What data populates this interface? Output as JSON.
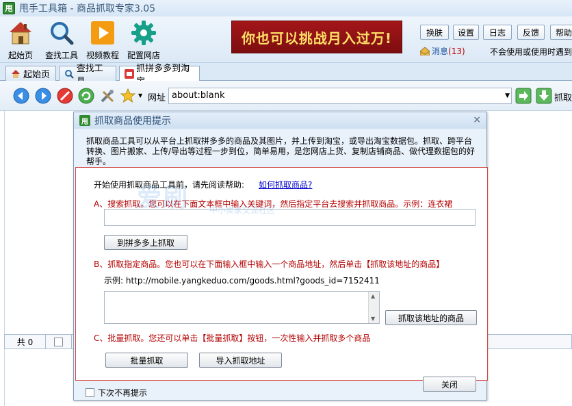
{
  "window": {
    "title": "甩手工具箱 - 商品抓取专家3.05",
    "logo_text": "甩"
  },
  "toolbar": {
    "items": [
      {
        "label": "起始页",
        "icon": "home-icon"
      },
      {
        "label": "查找工具",
        "icon": "search-icon"
      },
      {
        "label": "视频教程",
        "icon": "play-icon"
      },
      {
        "label": "配置网店",
        "icon": "gear-icon"
      }
    ],
    "banner": "你也可以挑战月入过万!",
    "buttons": [
      "换肤",
      "设置",
      "日志",
      "反馈",
      "帮助"
    ],
    "messages_label": "消息",
    "messages_count": "(13)",
    "marquee": "不会使用或使用时遇到"
  },
  "tabs": [
    {
      "label": "起始页",
      "icon": "home-icon"
    },
    {
      "label": "查找工具",
      "icon": "search-icon"
    },
    {
      "label": "抓拼多多到淘宝",
      "icon": "grab-icon",
      "active": true
    }
  ],
  "navbar": {
    "url_label": "网址",
    "url_value": "about:blank",
    "grab_label": "抓取"
  },
  "list": {
    "count_label": "共 0"
  },
  "dialog": {
    "title": "抓取商品使用提示",
    "logo_text": "甩",
    "close": "×",
    "intro": "抓取商品工具可以从平台上抓取拼多多的商品及其图片，并上传到淘宝，或导出淘宝数据包。抓取、跨平台转换、图片搬家、上传/导出等过程一步到位，简单易用，是您网店上货、复制店铺商品、做代理数据包的好帮手。",
    "start_text": "开始使用抓取商品工具前，请先阅读帮助:",
    "help_link": "如何抓取商品?",
    "section_a": "A、搜索抓取。您可以在下面文本框中输入关键词，然后指定平台去搜索并抓取商品。示例：连衣裙",
    "btn_grab_pdd": "到拼多多上抓取",
    "section_b": "B、抓取指定商品。您也可以在下面输入框中输入一个商品地址，然后单击【抓取该地址的商品】",
    "example": "示例: http://mobile.yangkeduo.com/goods.html?goods_id=7152411",
    "btn_grab_url": "抓取该地址的商品",
    "section_c": "C、批量抓取。您还可以单击【批量抓取】按钮，一次性输入并抓取多个商品",
    "btn_batch": "批量抓取",
    "btn_import": "导入抓取地址",
    "btn_close": "关闭",
    "dont_show": "下次不再提示"
  },
  "watermark": {
    "main": "爱刷",
    "sub": "中小卖家交流社区"
  }
}
